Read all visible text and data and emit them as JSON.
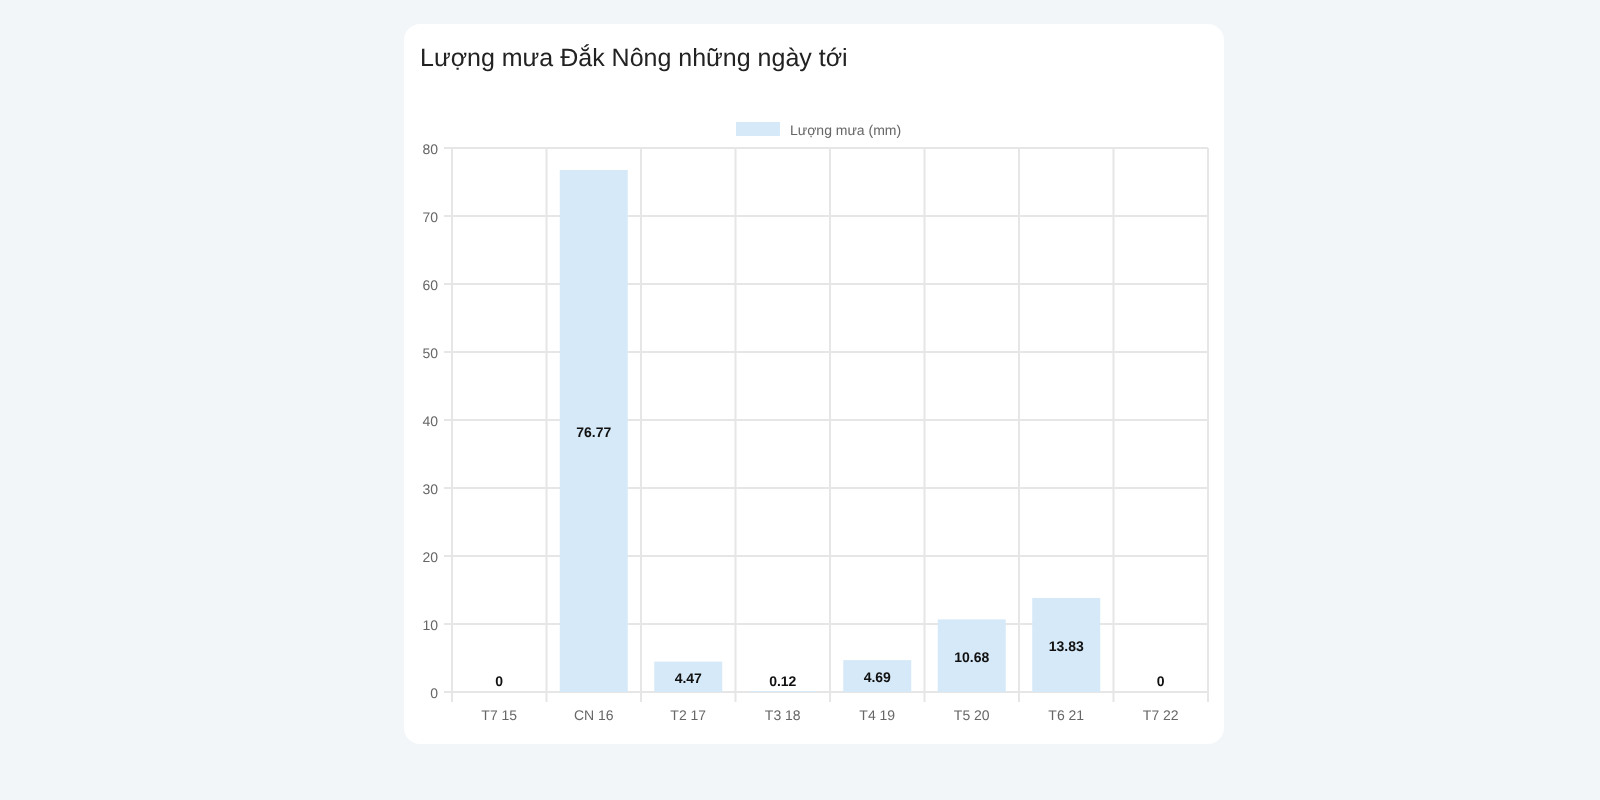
{
  "card": {
    "title": "Lượng mưa Đắk Nông những ngày tới",
    "chart_data": {
      "type": "bar",
      "categories": [
        "T7 15",
        "CN 16",
        "T2 17",
        "T3 18",
        "T4 19",
        "T5 20",
        "T6 21",
        "T7 22"
      ],
      "series": [
        {
          "name": "Lượng mưa (mm)",
          "color": "#d6e9f8",
          "values": [
            0,
            76.77,
            4.47,
            0.12,
            4.69,
            10.68,
            13.83,
            0
          ]
        }
      ],
      "ylim": [
        0,
        80
      ],
      "grid": true,
      "yticks": [
        0,
        10,
        20,
        30,
        40,
        50,
        60,
        70,
        80
      ],
      "data_labels": true,
      "value_labels": [
        "0",
        "76.77",
        "4.47",
        "0.12",
        "4.69",
        "10.68",
        "13.83",
        "0"
      ]
    }
  }
}
